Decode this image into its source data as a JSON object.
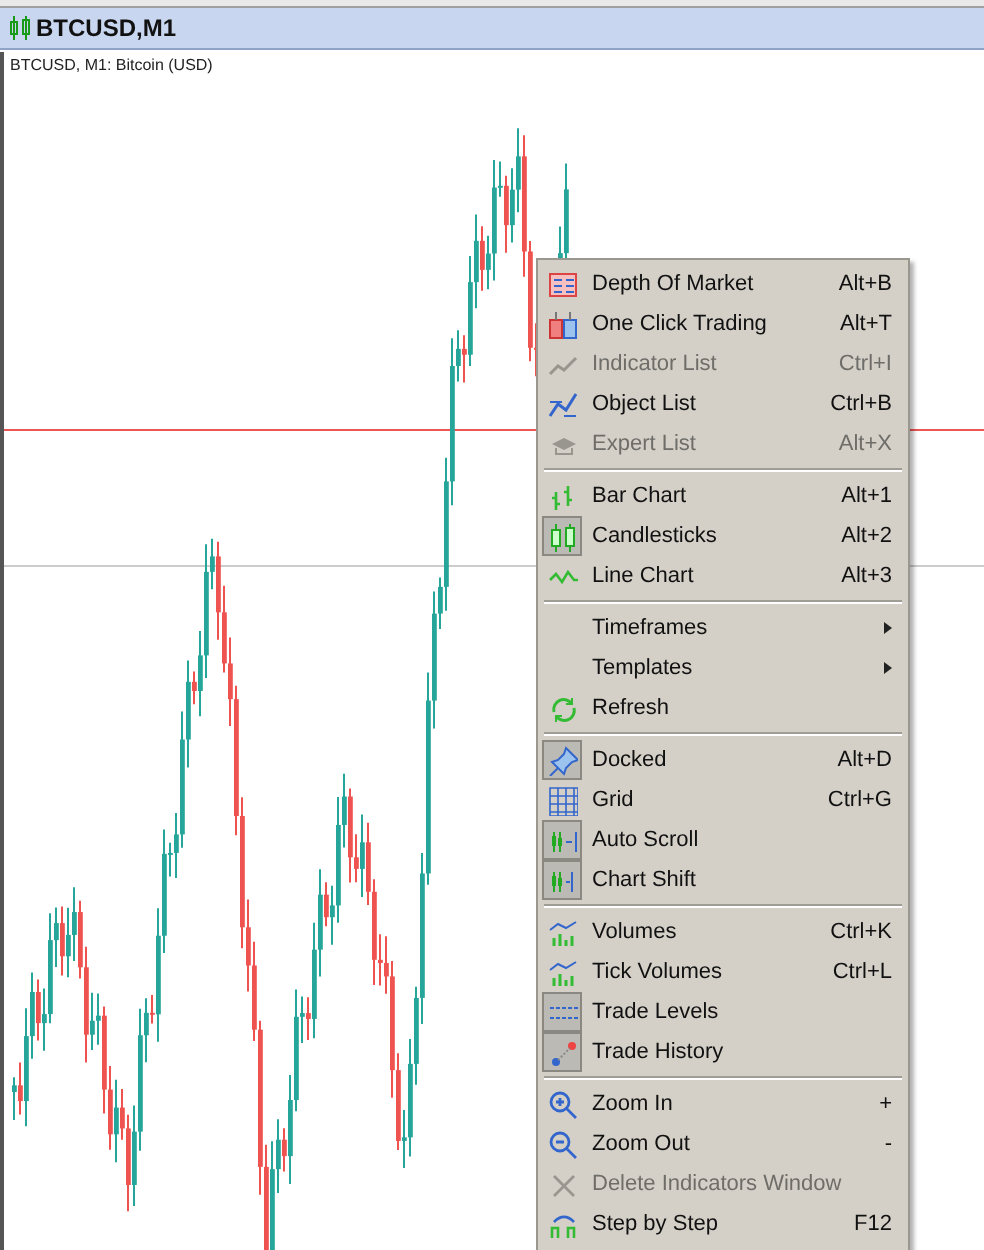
{
  "window": {
    "title": "BTCUSD,M1"
  },
  "chart": {
    "label": "BTCUSD, M1:  Bitcoin (USD)"
  },
  "context_menu": {
    "groups": [
      [
        {
          "label": "Depth Of Market",
          "shortcut": "Alt+B",
          "disabled": false,
          "checked": false
        },
        {
          "label": "One Click Trading",
          "shortcut": "Alt+T",
          "disabled": false,
          "checked": false
        },
        {
          "label": "Indicator List",
          "shortcut": "Ctrl+I",
          "disabled": true,
          "checked": false
        },
        {
          "label": "Object List",
          "shortcut": "Ctrl+B",
          "disabled": false,
          "checked": false
        },
        {
          "label": "Expert List",
          "shortcut": "Alt+X",
          "disabled": true,
          "checked": false
        }
      ],
      [
        {
          "label": "Bar Chart",
          "shortcut": "Alt+1",
          "disabled": false,
          "checked": false
        },
        {
          "label": "Candlesticks",
          "shortcut": "Alt+2",
          "disabled": false,
          "checked": true
        },
        {
          "label": "Line Chart",
          "shortcut": "Alt+3",
          "disabled": false,
          "checked": false
        }
      ],
      [
        {
          "label": "Timeframes",
          "submenu": true,
          "disabled": false,
          "checked": false
        },
        {
          "label": "Templates",
          "submenu": true,
          "disabled": false,
          "checked": false
        },
        {
          "label": "Refresh",
          "disabled": false,
          "checked": false
        }
      ],
      [
        {
          "label": "Docked",
          "shortcut": "Alt+D",
          "disabled": false,
          "checked": true
        },
        {
          "label": "Grid",
          "shortcut": "Ctrl+G",
          "disabled": false,
          "checked": false
        },
        {
          "label": "Auto Scroll",
          "disabled": false,
          "checked": true
        },
        {
          "label": "Chart Shift",
          "disabled": false,
          "checked": true
        }
      ],
      [
        {
          "label": "Volumes",
          "shortcut": "Ctrl+K",
          "disabled": false,
          "checked": false
        },
        {
          "label": "Tick Volumes",
          "shortcut": "Ctrl+L",
          "disabled": false,
          "checked": false
        },
        {
          "label": "Trade Levels",
          "disabled": false,
          "checked": true
        },
        {
          "label": "Trade History",
          "disabled": false,
          "checked": true
        }
      ],
      [
        {
          "label": "Zoom In",
          "shortcut": "+",
          "disabled": false,
          "checked": false
        },
        {
          "label": "Zoom Out",
          "shortcut": "-",
          "disabled": false,
          "checked": false
        },
        {
          "label": "Delete Indicators Window",
          "disabled": true,
          "checked": false
        },
        {
          "label": "Step by Step",
          "shortcut": "F12",
          "disabled": false,
          "checked": false
        }
      ]
    ]
  }
}
